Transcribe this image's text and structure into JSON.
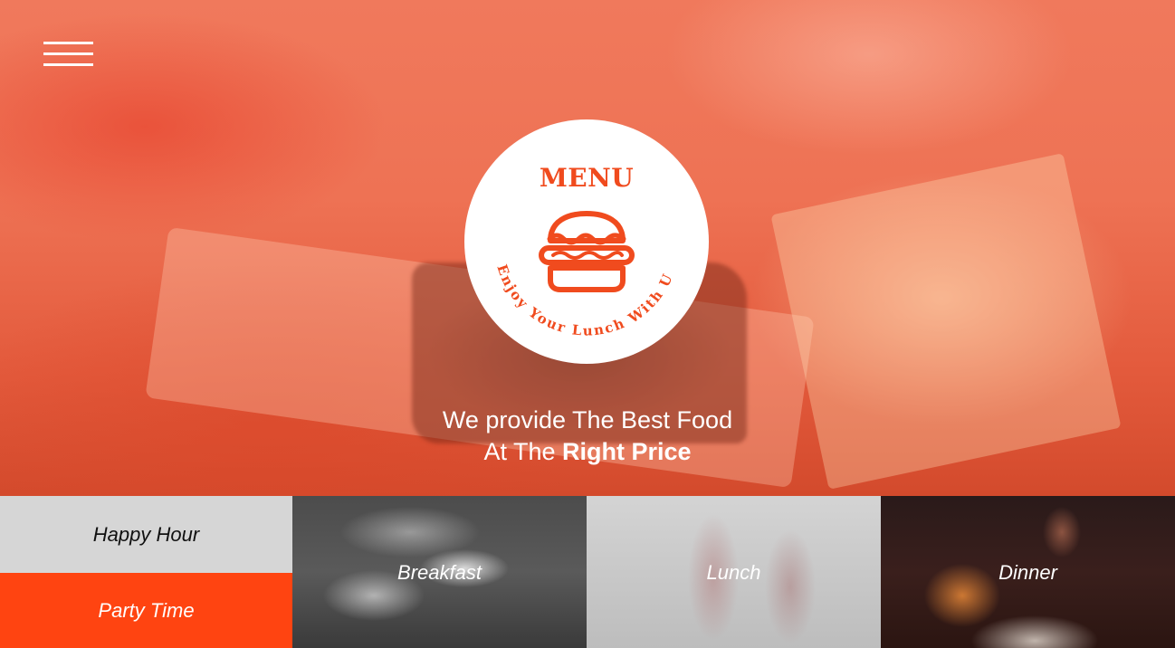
{
  "header": {
    "menu_toggle_icon": "hamburger-icon"
  },
  "badge": {
    "title": "MENU",
    "icon": "burger-icon",
    "arc_text": "Enjoy Your Lunch With Us",
    "accent_color": "#f04b1e"
  },
  "tagline": {
    "line1": "We provide The Best Food",
    "line2_prefix": "At The ",
    "line2_bold": "Right Price"
  },
  "categories": {
    "happy_hour": "Happy Hour",
    "party_time": "Party Time",
    "breakfast": "Breakfast",
    "lunch": "Lunch",
    "dinner": "Dinner"
  },
  "colors": {
    "hero_overlay": "#ee7254",
    "party_time_bg": "#ff4411",
    "happy_hour_bg": "#d6d6d6"
  }
}
